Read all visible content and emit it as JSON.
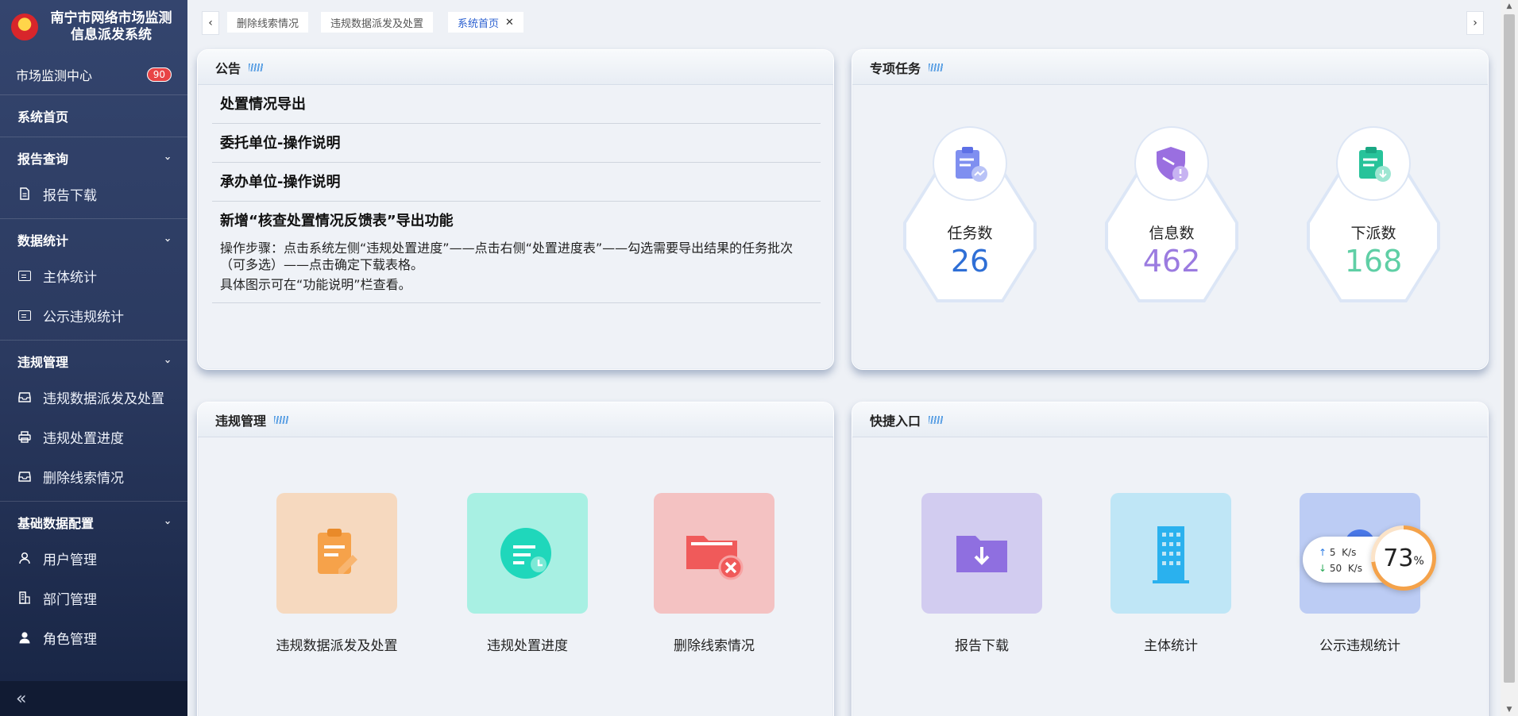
{
  "app": {
    "title_line1": "南宁市网络市场监测",
    "title_line2": "信息派发系统"
  },
  "sidebar": {
    "center_label": "市场监测中心",
    "center_badge": "90",
    "home": "系统首页",
    "sections": [
      {
        "label": "报告查询",
        "items": [
          {
            "label": "报告下载",
            "icon": "file-icon"
          }
        ]
      },
      {
        "label": "数据统计",
        "items": [
          {
            "label": "主体统计",
            "icon": "card-icon"
          },
          {
            "label": "公示违规统计",
            "icon": "card-icon"
          }
        ]
      },
      {
        "label": "违规管理",
        "items": [
          {
            "label": "违规数据派发及处置",
            "icon": "inbox-icon"
          },
          {
            "label": "违规处置进度",
            "icon": "printer-icon"
          },
          {
            "label": "删除线索情况",
            "icon": "inbox-icon"
          }
        ]
      },
      {
        "label": "基础数据配置",
        "items": [
          {
            "label": "用户管理",
            "icon": "user-outline-icon"
          },
          {
            "label": "部门管理",
            "icon": "building-icon"
          },
          {
            "label": "角色管理",
            "icon": "user-solid-icon"
          }
        ]
      }
    ],
    "collapse_icon": "«"
  },
  "tabs": [
    {
      "label": "删除线索情况"
    },
    {
      "label": "违规数据派发及处置"
    },
    {
      "label": "系统首页",
      "active": true
    }
  ],
  "notice": {
    "title": "公告",
    "items": [
      {
        "title": "处置情况导出"
      },
      {
        "title": "委托单位-操作说明"
      },
      {
        "title": "承办单位-操作说明"
      },
      {
        "title": "新增“核查处置情况反馈表”导出功能",
        "body1": "操作步骤：点击系统左侧“违规处置进度”——点击右侧“处置进度表”——勾选需要导出结果的任务批次（可多选）——点击确定下载表格。",
        "body2": "具体图示可在“功能说明”栏查看。"
      }
    ]
  },
  "tasks": {
    "title": "专项任务",
    "stats": [
      {
        "label": "任务数",
        "value": "26",
        "color": "#2f6fd6",
        "icon": "clipboard-chart-icon"
      },
      {
        "label": "信息数",
        "value": "462",
        "color": "#9b7be0",
        "icon": "shield-alert-icon"
      },
      {
        "label": "下派数",
        "value": "168",
        "color": "#5fcfa5",
        "icon": "clipboard-download-icon"
      }
    ]
  },
  "violations": {
    "title": "违规管理",
    "tiles": [
      {
        "label": "违规数据派发及处置",
        "bg": "#f6d9bf",
        "fg": "#f6a24a",
        "icon": "clipboard-edit-icon"
      },
      {
        "label": "违规处置进度",
        "bg": "#a8f0e3",
        "fg": "#1fd7bb",
        "icon": "progress-clock-icon"
      },
      {
        "label": "删除线索情况",
        "bg": "#f4c2c2",
        "fg": "#f05a5a",
        "icon": "folder-delete-icon"
      }
    ]
  },
  "shortcuts": {
    "title": "快捷入口",
    "tiles": [
      {
        "label": "报告下载",
        "bg": "#d2ccf0",
        "fg": "#8f6fe0",
        "icon": "folder-download-icon"
      },
      {
        "label": "主体统计",
        "bg": "#bfe6f6",
        "fg": "#2ab1ee",
        "icon": "building-icon"
      },
      {
        "label": "公示违规统计",
        "bg": "#bcccf4",
        "fg": "#4a78e8",
        "icon": "bell-icon"
      }
    ]
  },
  "speed": {
    "up_value": "5",
    "up_unit": "K/s",
    "down_value": "50",
    "down_unit": "K/s",
    "percent": "73",
    "percent_sign": "%"
  }
}
